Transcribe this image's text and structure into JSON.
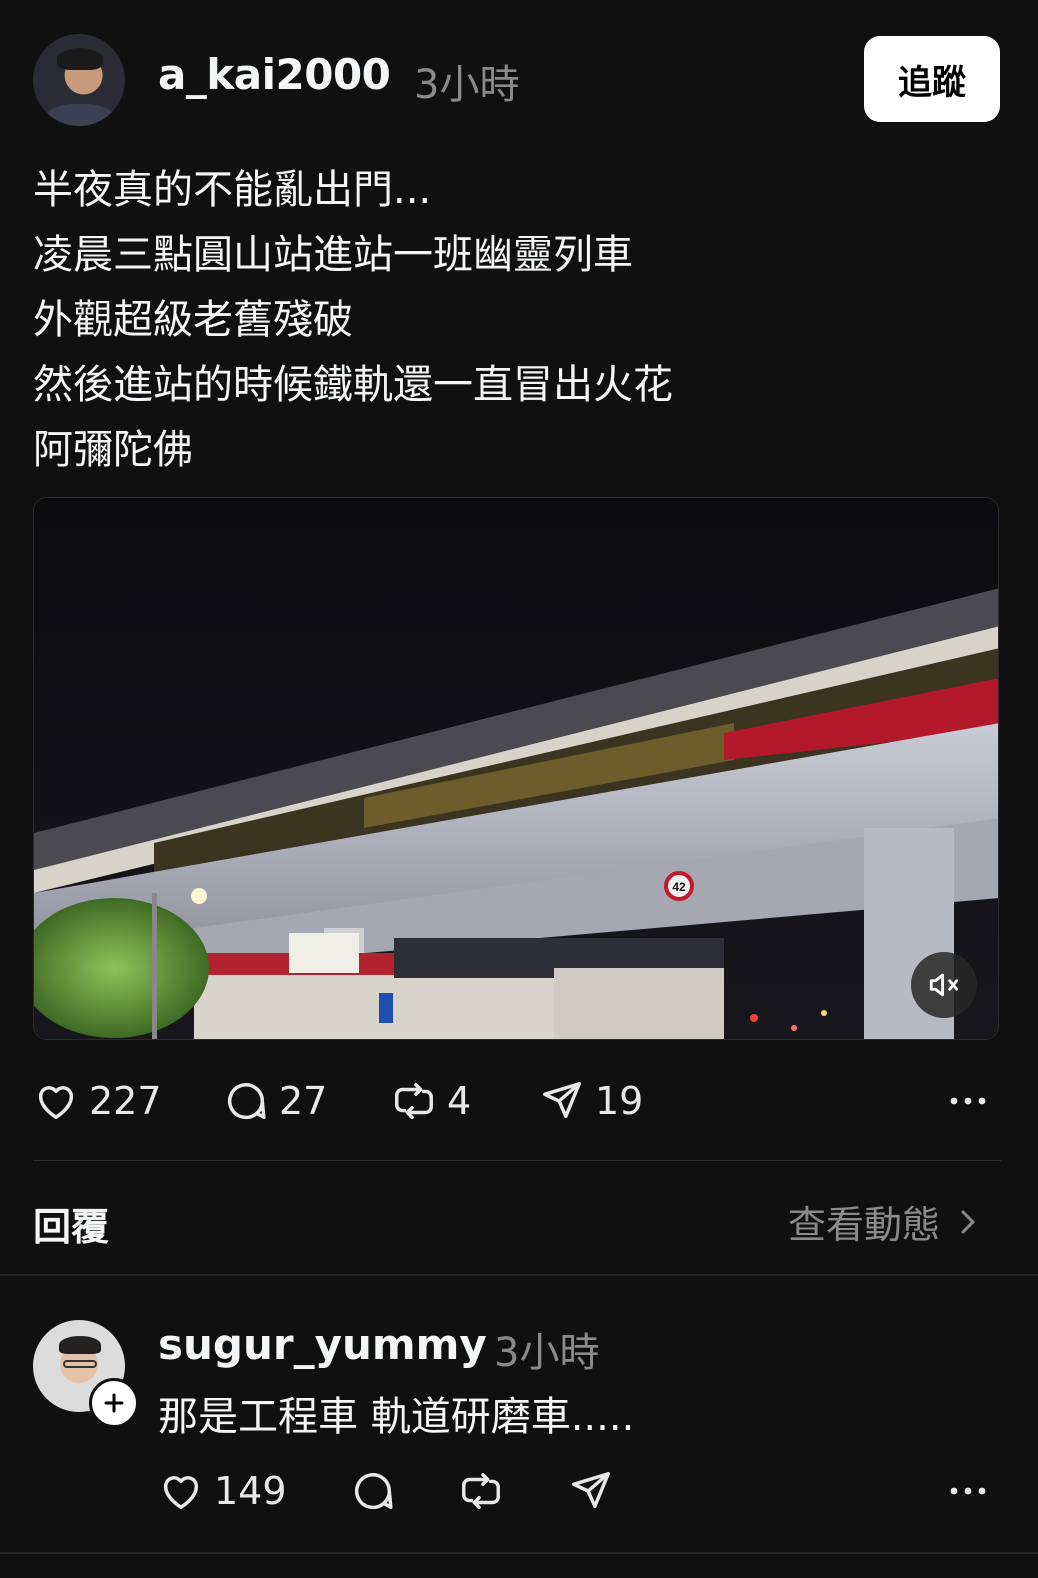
{
  "post": {
    "username": "a_kai2000",
    "time": "3小時",
    "follow_label": "追蹤",
    "lines": [
      "半夜真的不能亂出門...",
      "凌晨三點圓山站進站一班幽靈列車",
      "外觀超級老舊殘破",
      "然後進站的時候鐵軌還一直冒出火花",
      "阿彌陀佛"
    ],
    "media": {
      "sign_number": "42",
      "muted": true
    },
    "stats": {
      "likes": "227",
      "comments": "27",
      "reposts": "4",
      "shares": "19"
    }
  },
  "replies_header": {
    "label": "回覆",
    "view_activity": "查看動態"
  },
  "reply": {
    "username": "sugur_yummy",
    "time": "3小時",
    "text": "那是工程車 軌道研磨車.....",
    "likes": "149"
  },
  "icons": {
    "like": "heart-icon",
    "comment": "comment-bubble-icon",
    "repost": "repost-icon",
    "share": "send-icon",
    "more": "more-dots-icon",
    "mute": "speaker-muted-icon",
    "chevron": "chevron-right-icon",
    "follow_plus": "plus-icon"
  },
  "colors": {
    "background": "#101010",
    "text": "#f3f5f7",
    "secondary_text": "#8a8a8a",
    "follow_button": "#ffffff"
  }
}
